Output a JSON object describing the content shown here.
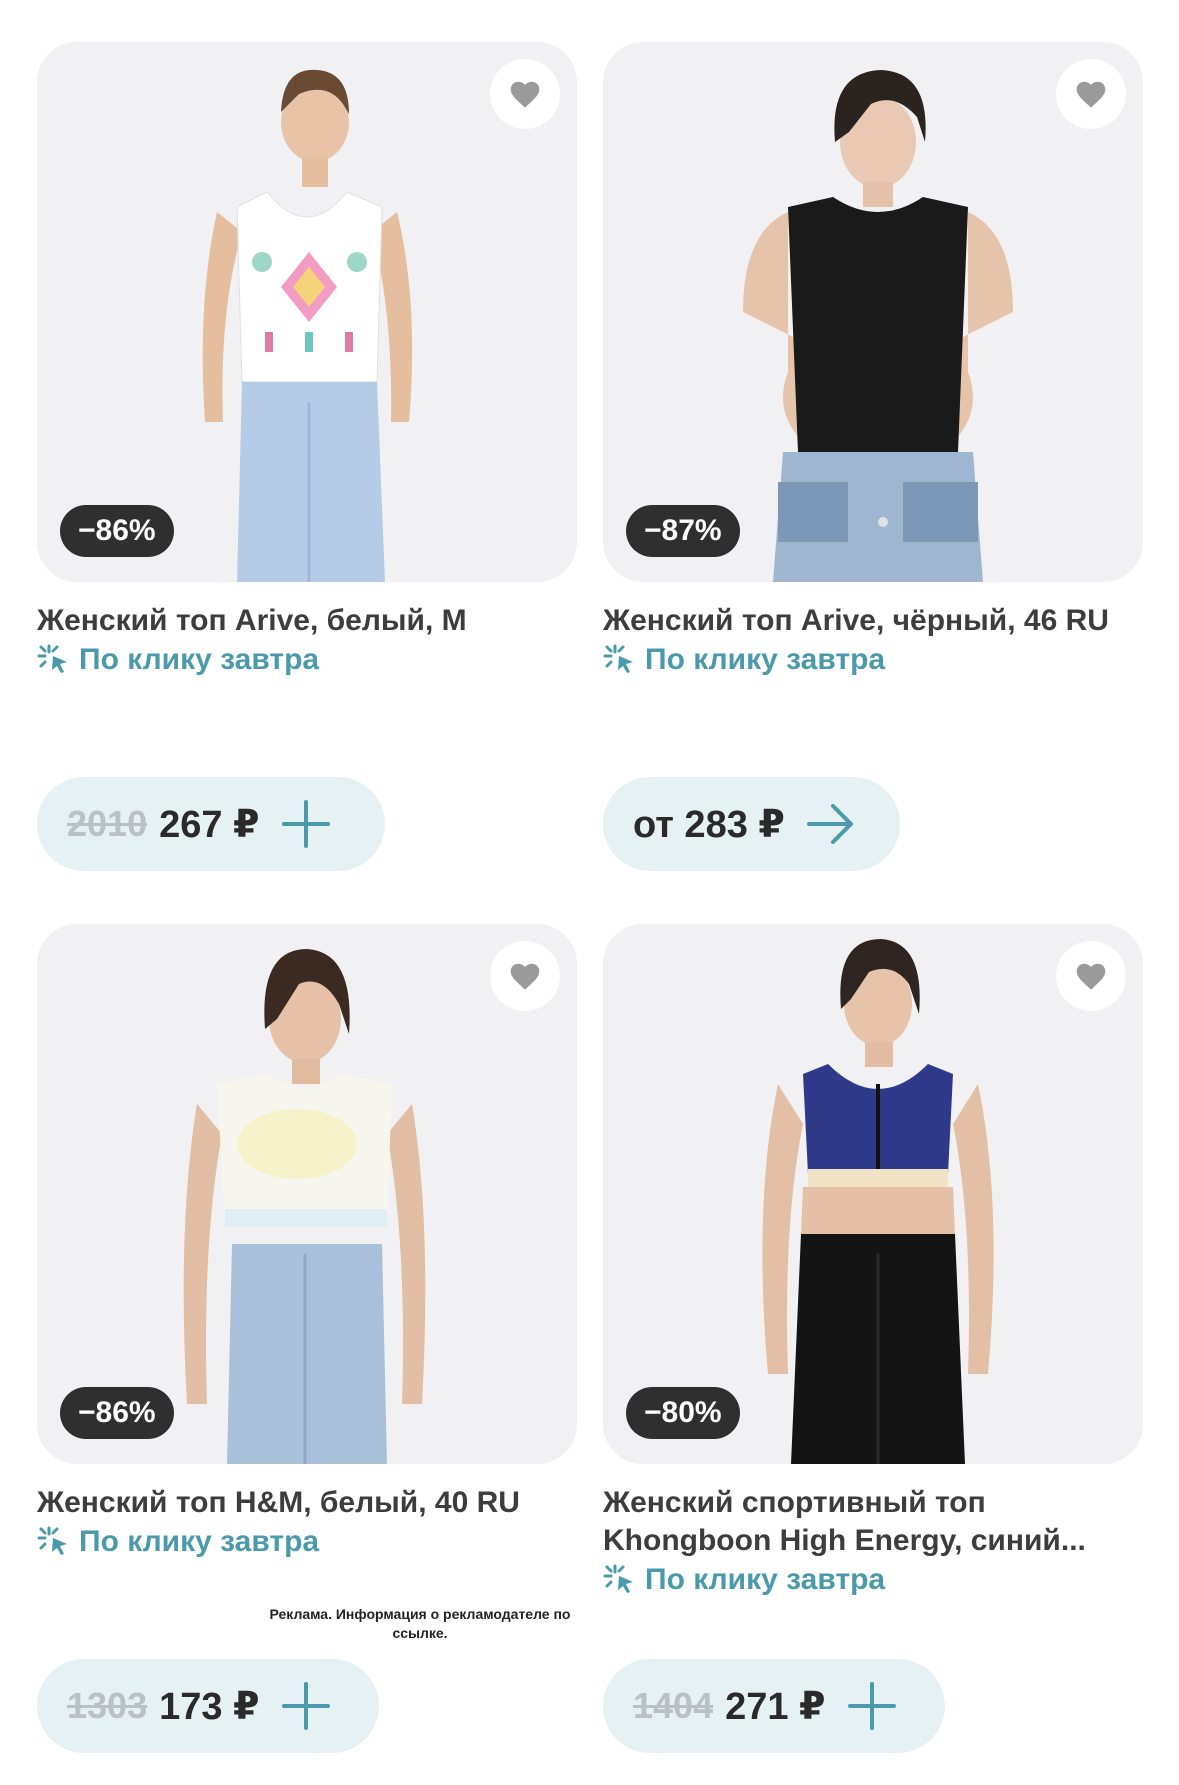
{
  "products": [
    {
      "title": "Женский топ Arive, белый, M",
      "discount": "−86%",
      "delivery": "По клику завтра",
      "old_price": "2010",
      "price": "267 ₽",
      "action": "add"
    },
    {
      "title": "Женский топ Arive, чёрный, 46 RU",
      "discount": "−87%",
      "delivery": "По клику завтра",
      "old_price": "",
      "price": "от 283 ₽",
      "action": "open"
    },
    {
      "title": "Женский топ H&M, белый, 40 RU",
      "discount": "−86%",
      "delivery": "По клику завтра",
      "old_price": "1303",
      "price": "173 ₽",
      "action": "add"
    },
    {
      "title": "Женский спортивный топ Khongboon High Energy, синий...",
      "discount": "−80%",
      "delivery": "По клику завтра",
      "old_price": "1404",
      "price": "271 ₽",
      "action": "add"
    }
  ],
  "ad_note": "Реклама. Информация о рекламодателе по ссылке.",
  "icons": {
    "favorite": "heart-icon",
    "delivery": "click-sparkle-icon",
    "add": "plus-icon",
    "open": "arrow-right-icon"
  },
  "colors": {
    "accent": "#4a9aac",
    "price_button_bg": "#e6f1f4",
    "badge_bg": "#2f2f2f",
    "photo_bg": "#f1f1f3"
  }
}
